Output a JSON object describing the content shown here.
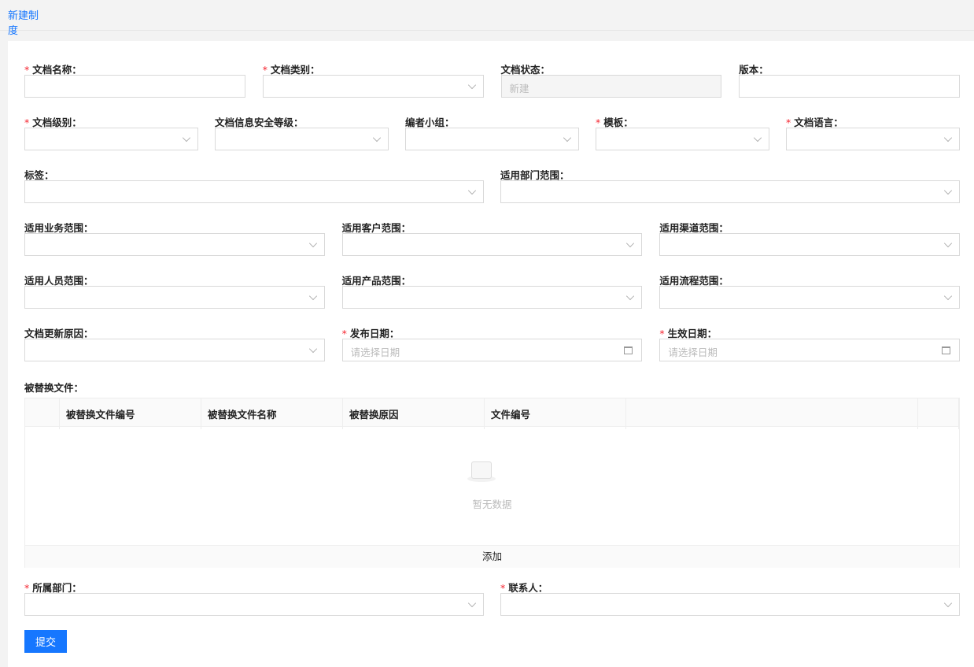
{
  "tab": "新建制度",
  "rows": [
    [
      {
        "label": "文档名称：",
        "required": true,
        "type": "text"
      },
      {
        "label": "文档类别：",
        "required": true,
        "type": "select"
      },
      {
        "label": "文档状态：",
        "required": false,
        "type": "disabled",
        "value": "新建"
      },
      {
        "label": "版本：",
        "required": false,
        "type": "text"
      }
    ],
    [
      {
        "label": "文档级别：",
        "required": true,
        "type": "select"
      },
      {
        "label": "文档信息安全等级：",
        "required": false,
        "type": "select"
      },
      {
        "label": "编者小组：",
        "required": false,
        "type": "select"
      },
      {
        "label": "模板：",
        "required": true,
        "type": "select"
      },
      {
        "label": "文档语言：",
        "required": true,
        "type": "select"
      }
    ],
    [
      {
        "label": "标签：",
        "required": false,
        "type": "select"
      },
      {
        "label": "适用部门范围：",
        "required": false,
        "type": "select"
      }
    ],
    [
      {
        "label": "适用业务范围：",
        "required": false,
        "type": "select"
      },
      {
        "label": "适用客户范围：",
        "required": false,
        "type": "select"
      },
      {
        "label": "适用渠道范围：",
        "required": false,
        "type": "select"
      }
    ],
    [
      {
        "label": "适用人员范围：",
        "required": false,
        "type": "select"
      },
      {
        "label": "适用产品范围：",
        "required": false,
        "type": "select"
      },
      {
        "label": "适用流程范围：",
        "required": false,
        "type": "select"
      }
    ],
    [
      {
        "label": "文档更新原因：",
        "required": false,
        "type": "select"
      },
      {
        "label": "发布日期：",
        "required": true,
        "type": "date",
        "placeholder": "请选择日期"
      },
      {
        "label": "生效日期：",
        "required": true,
        "type": "date",
        "placeholder": "请选择日期"
      }
    ]
  ],
  "replaced": {
    "label": "被替换文件：",
    "columns": [
      "",
      "被替换文件编号",
      "被替换文件名称",
      "被替换原因",
      "文件编号",
      "",
      ""
    ],
    "empty": "暂无数据",
    "add": "添加"
  },
  "bottom": [
    {
      "label": "所属部门：",
      "required": true,
      "type": "select"
    },
    {
      "label": "联系人：",
      "required": true,
      "type": "select"
    }
  ],
  "submit": "提交",
  "colors": {
    "primary": "#1677ff",
    "required": "#f5222d"
  }
}
